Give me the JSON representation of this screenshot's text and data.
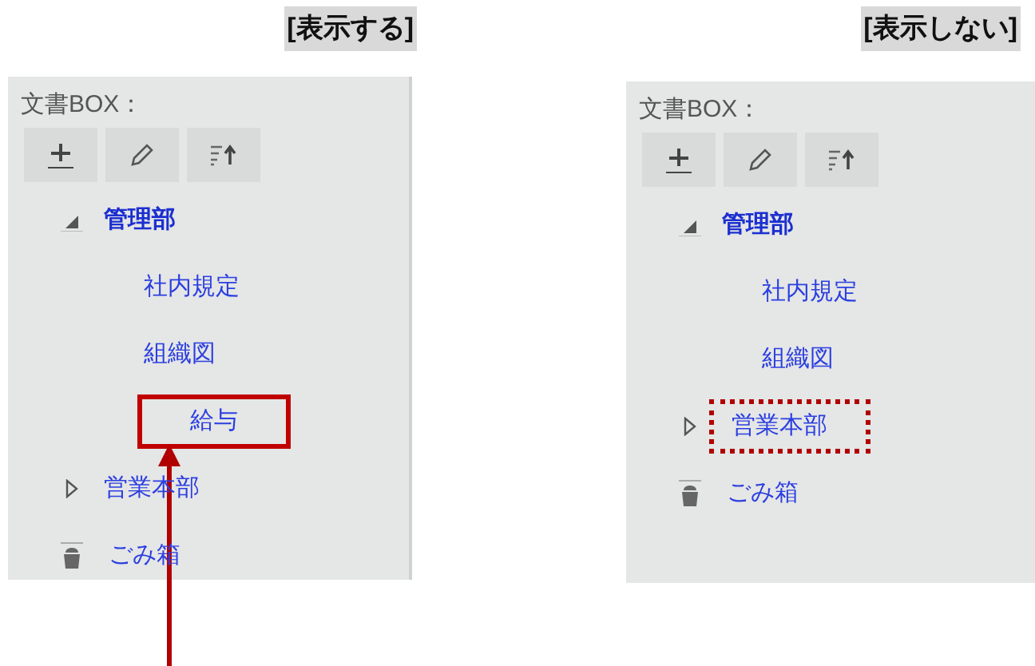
{
  "panels": [
    {
      "caption": "[表示する]",
      "box_title": "文書BOX：",
      "pointer_arrow": true,
      "items": [
        {
          "label": "管理部",
          "kind": "folder",
          "expanded": true,
          "selected": true,
          "children": [
            {
              "label": "社内規定",
              "kind": "document",
              "selected": false
            },
            {
              "label": "組織図",
              "kind": "document",
              "selected": false
            },
            {
              "label": "給与",
              "kind": "document",
              "selected": false,
              "highlighted": true,
              "dotted": false
            }
          ]
        },
        {
          "label": "営業本部",
          "kind": "folder",
          "expanded": false,
          "selected": false
        },
        {
          "label": "ごみ箱",
          "kind": "trash",
          "selected": false
        }
      ]
    },
    {
      "caption": "[表示しない]",
      "box_title": "文書BOX：",
      "items": [
        {
          "label": "管理部",
          "kind": "folder",
          "expanded": true,
          "selected": true,
          "children": [
            {
              "label": "社内規定",
              "kind": "document",
              "selected": false
            },
            {
              "label": "組織図",
              "kind": "document",
              "selected": false
            }
          ]
        },
        {
          "label": "営業本部",
          "kind": "folder",
          "expanded": false,
          "selected": false,
          "highlighted": true,
          "dotted": true
        },
        {
          "label": "ごみ箱",
          "kind": "trash",
          "selected": false
        }
      ]
    }
  ]
}
